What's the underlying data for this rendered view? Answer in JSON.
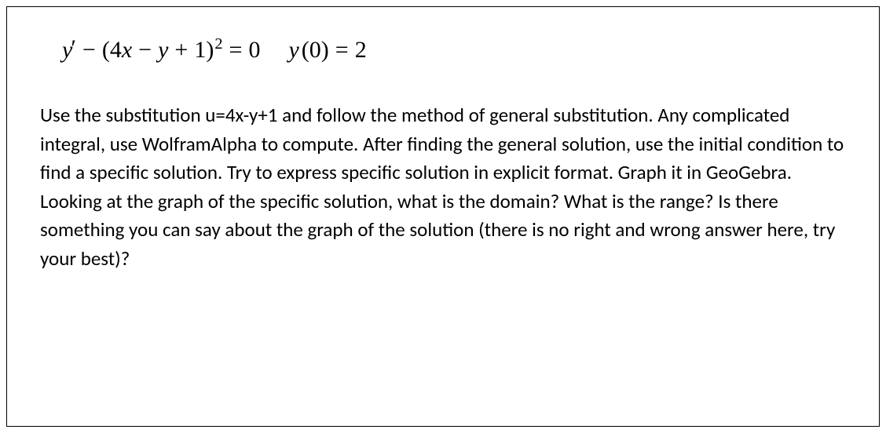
{
  "equation1": {
    "y": "y",
    "prime": "′",
    "minus1": "−",
    "lparen1": "(",
    "four": "4",
    "x": "x",
    "minus2": "−",
    "y2": "y",
    "plus": "+",
    "one": "1",
    "rparen1": ")",
    "sq": "2",
    "eq": "=",
    "zero": "0"
  },
  "equation2": {
    "y": "y",
    "lparen": "(",
    "zero": "0",
    "rparen": ")",
    "eq": "=",
    "two": "2"
  },
  "instructions_text": "Use the substitution u=4x-y+1 and follow the method of general substitution. Any complicated integral, use WolframAlpha to compute. After finding the general solution, use the initial condition to find a specific solution. Try to express specific solution in explicit format. Graph it in GeoGebra. Looking at the graph of the specific solution, what is the domain? What is the range? Is there something you can say about the graph of the solution (there is no right and wrong answer here, try your best)?"
}
